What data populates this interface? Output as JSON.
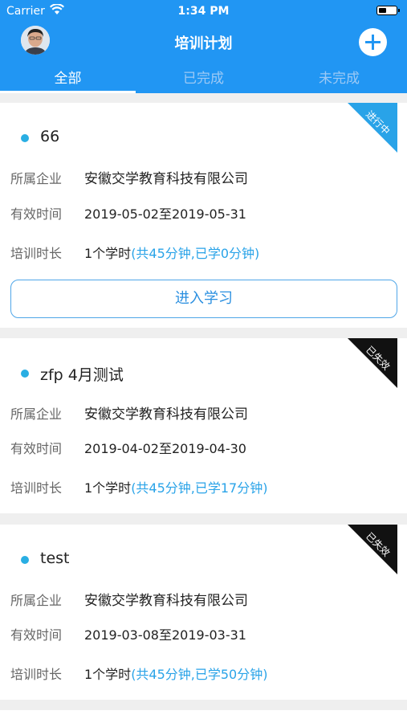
{
  "status_bar": {
    "carrier": "Carrier",
    "time": "1:34 PM"
  },
  "header": {
    "title": "培训计划"
  },
  "tabs": [
    {
      "label": "全部",
      "active": true
    },
    {
      "label": "已完成",
      "active": false
    },
    {
      "label": "未完成",
      "active": false
    }
  ],
  "field_labels": {
    "company": "所属企业",
    "period": "有效时间",
    "duration": "培训时长"
  },
  "cards": [
    {
      "title": "66",
      "company": "安徽交学教育科技有限公司",
      "period": "2019-05-02至2019-05-31",
      "duration_main": "1个学时",
      "duration_detail": "(共45分钟,已学0分钟)",
      "status": "进行中",
      "status_color": "#29a3e8",
      "button_label": "进入学习"
    },
    {
      "title": "zfp 4月测试",
      "company": "安徽交学教育科技有限公司",
      "period": "2019-04-02至2019-04-30",
      "duration_main": "1个学时",
      "duration_detail": "(共45分钟,已学17分钟)",
      "status": "已失效",
      "status_color": "#111111"
    },
    {
      "title": "test",
      "company": "安徽交学教育科技有限公司",
      "period": "2019-03-08至2019-03-31",
      "duration_main": "1个学时",
      "duration_detail": "(共45分钟,已学50分钟)",
      "status": "已失效",
      "status_color": "#111111"
    }
  ],
  "colors": {
    "header": "#2196f3",
    "accent": "#29a3e8"
  }
}
